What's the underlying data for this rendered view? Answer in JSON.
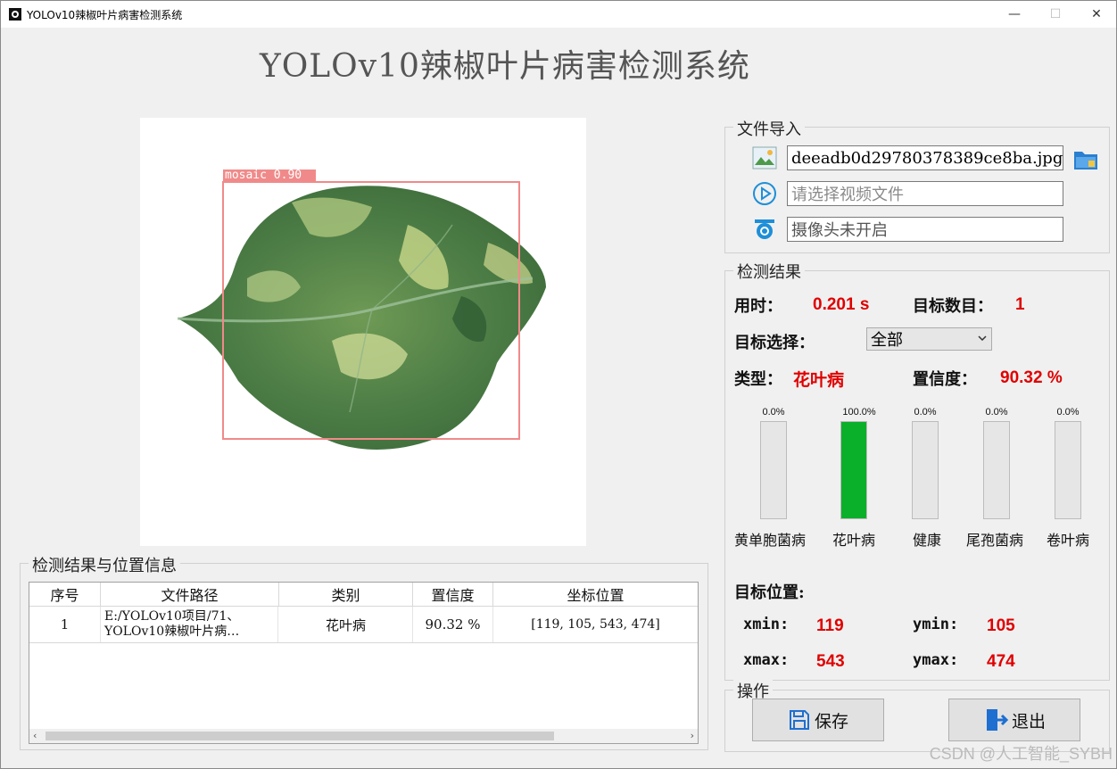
{
  "window": {
    "title": "YOLOv10辣椒叶片病害检测系统",
    "controls": {
      "minimize": "—",
      "maximize": "☐",
      "close": "✕"
    }
  },
  "heading": "YOLOv10辣椒叶片病害检测系统",
  "image_view": {
    "detection_label": "mosaic 0.90"
  },
  "file_import": {
    "legend": "文件导入",
    "image_file_value": "deeadb0d29780378389ce8ba.jpg",
    "video_placeholder": "请选择视频文件",
    "camera_status": "摄像头未开启"
  },
  "detection_result": {
    "legend": "检测结果",
    "time_label": "用时：",
    "time_value": "0.201 s",
    "count_label": "目标数目：",
    "count_value": "1",
    "target_select_label": "目标选择：",
    "target_select_value": "全部",
    "type_label": "类型：",
    "type_value": "花叶病",
    "confidence_label": "置信度：",
    "confidence_value": "90.32 %"
  },
  "probabilities": [
    {
      "name": "黄单胞菌病",
      "percent_label": "0.0%",
      "value": 0.0
    },
    {
      "name": "花叶病",
      "percent_label": "100.0%",
      "value": 1.0
    },
    {
      "name": "健康",
      "percent_label": "0.0%",
      "value": 0.0
    },
    {
      "name": "尾孢菌病",
      "percent_label": "0.0%",
      "value": 0.0
    },
    {
      "name": "卷叶病",
      "percent_label": "0.0%",
      "value": 0.0
    }
  ],
  "position": {
    "label": "目标位置:",
    "xmin_label": "xmin:",
    "xmin": "119",
    "ymin_label": "ymin:",
    "ymin": "105",
    "xmax_label": "xmax:",
    "xmax": "543",
    "ymax_label": "ymax:",
    "ymax": "474"
  },
  "operations": {
    "legend": "操作",
    "save_label": "保存",
    "exit_label": "退出"
  },
  "results_table": {
    "legend": "检测结果与位置信息",
    "headers": [
      "序号",
      "文件路径",
      "类别",
      "置信度",
      "坐标位置"
    ],
    "rows": [
      {
        "index": "1",
        "path_line1": "E:/YOLOv10项目/71、",
        "path_line2": "YOLOv10辣椒叶片病…",
        "category": "花叶病",
        "confidence": "90.32 %",
        "coords": "[119, 105, 543, 474]"
      }
    ]
  },
  "watermark": "CSDN @人工智能_SYBH",
  "colors": {
    "accent_red": "#e00000",
    "bar_green": "#0aaf2a",
    "box_pink": "#f08a8a"
  }
}
